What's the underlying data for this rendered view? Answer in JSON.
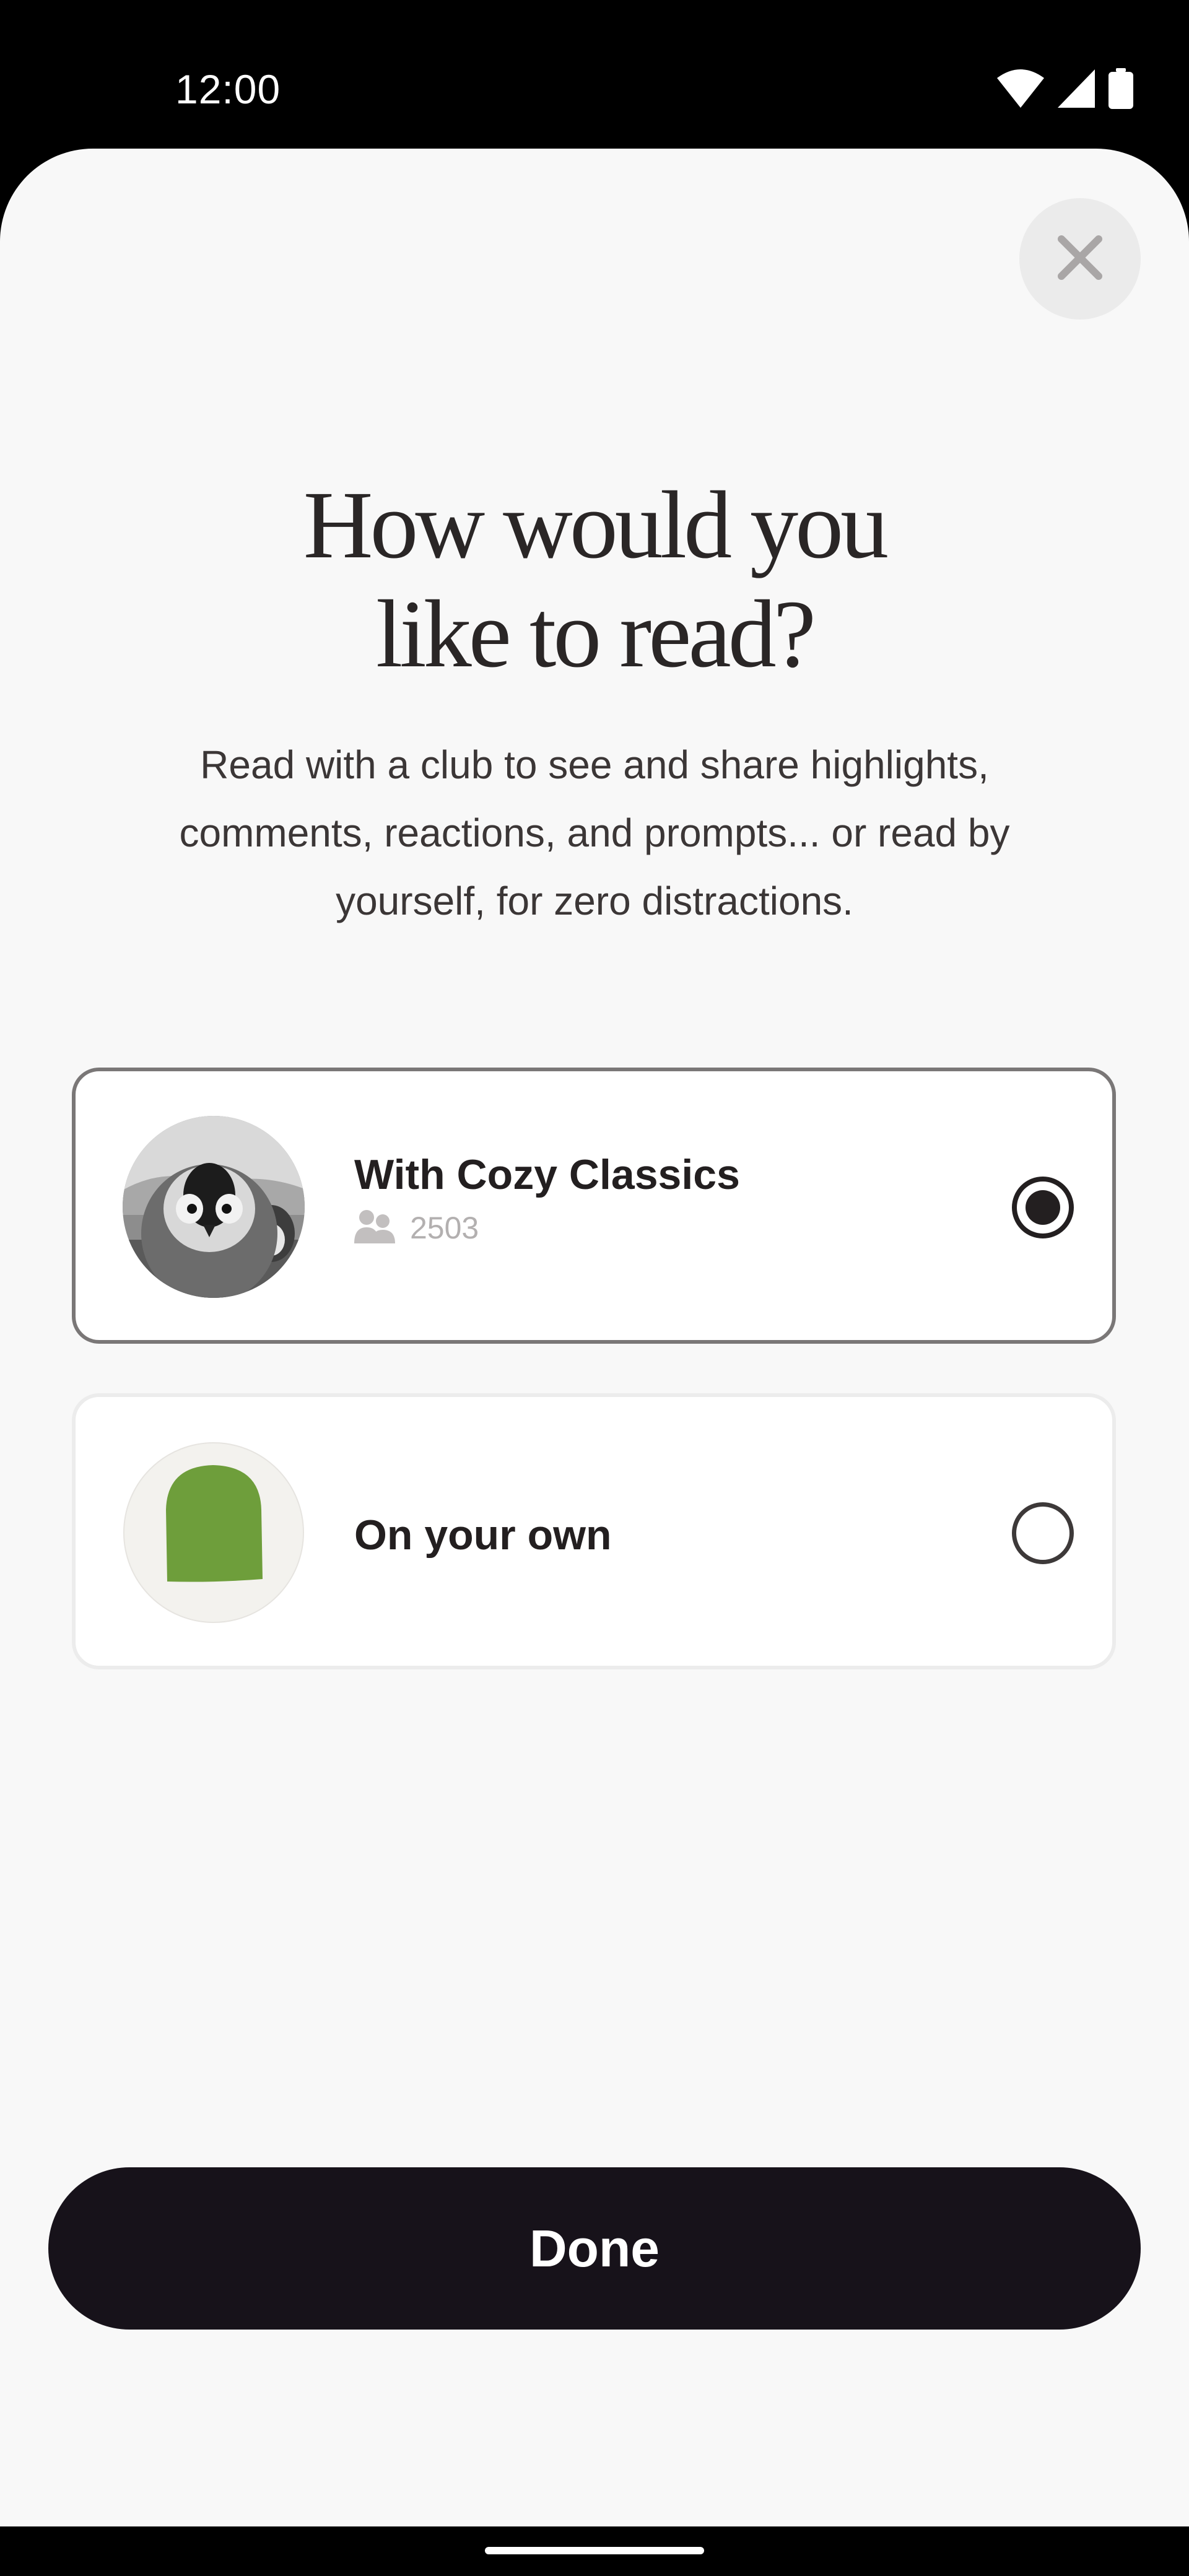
{
  "status_bar": {
    "time": "12:00",
    "icons": [
      "wifi-icon",
      "signal-icon",
      "battery-icon"
    ]
  },
  "sheet": {
    "close_icon": "close-icon",
    "title": "How would you\nlike to read?",
    "subtitle": "Read with a club to see and share highlights, comments, reactions, and prompts... or read by yourself, for zero distractions."
  },
  "options": [
    {
      "title": "With Cozy Classics",
      "member_count": "2503",
      "members_icon": "people-icon",
      "avatar": "penguin-photo",
      "selected": true
    },
    {
      "title": "On your own",
      "avatar": "green-shape-avatar",
      "selected": false
    }
  ],
  "done_button": {
    "label": "Done"
  },
  "colors": {
    "sheet_background": "#f8f8f8",
    "primary_dark": "#17121a",
    "accent_green": "#6e9e3b",
    "muted_text": "#b3b0b0"
  }
}
